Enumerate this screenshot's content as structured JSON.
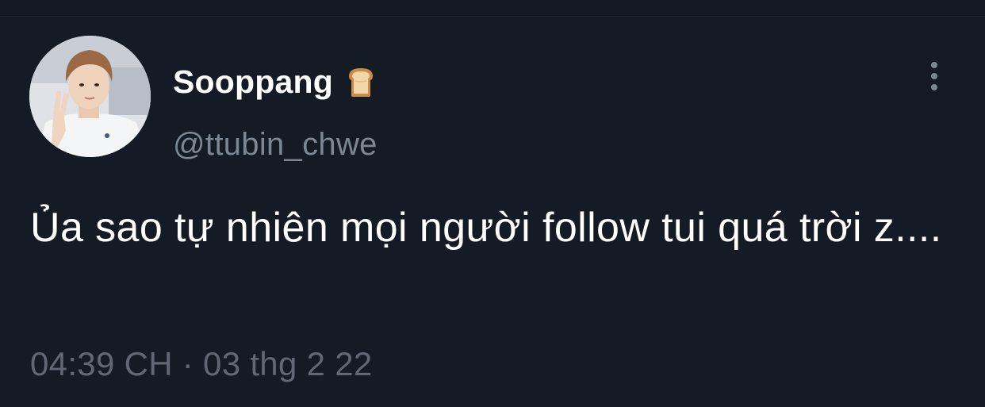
{
  "tweet": {
    "author": {
      "display_name": "Sooppang",
      "handle": "@ttubin_chwe",
      "name_emoji_icon": "bread-icon",
      "avatar_icon": "profile-avatar"
    },
    "text": "Ủa sao tự nhiên mọi người follow tui quá trời z....",
    "timestamp": "04:39 CH · 03 thg 2 22",
    "more_icon": "more-vertical-icon"
  },
  "colors": {
    "background": "#151b25",
    "text_primary": "#ffffff",
    "text_secondary": "#7c8794",
    "timestamp": "#5f6874"
  }
}
